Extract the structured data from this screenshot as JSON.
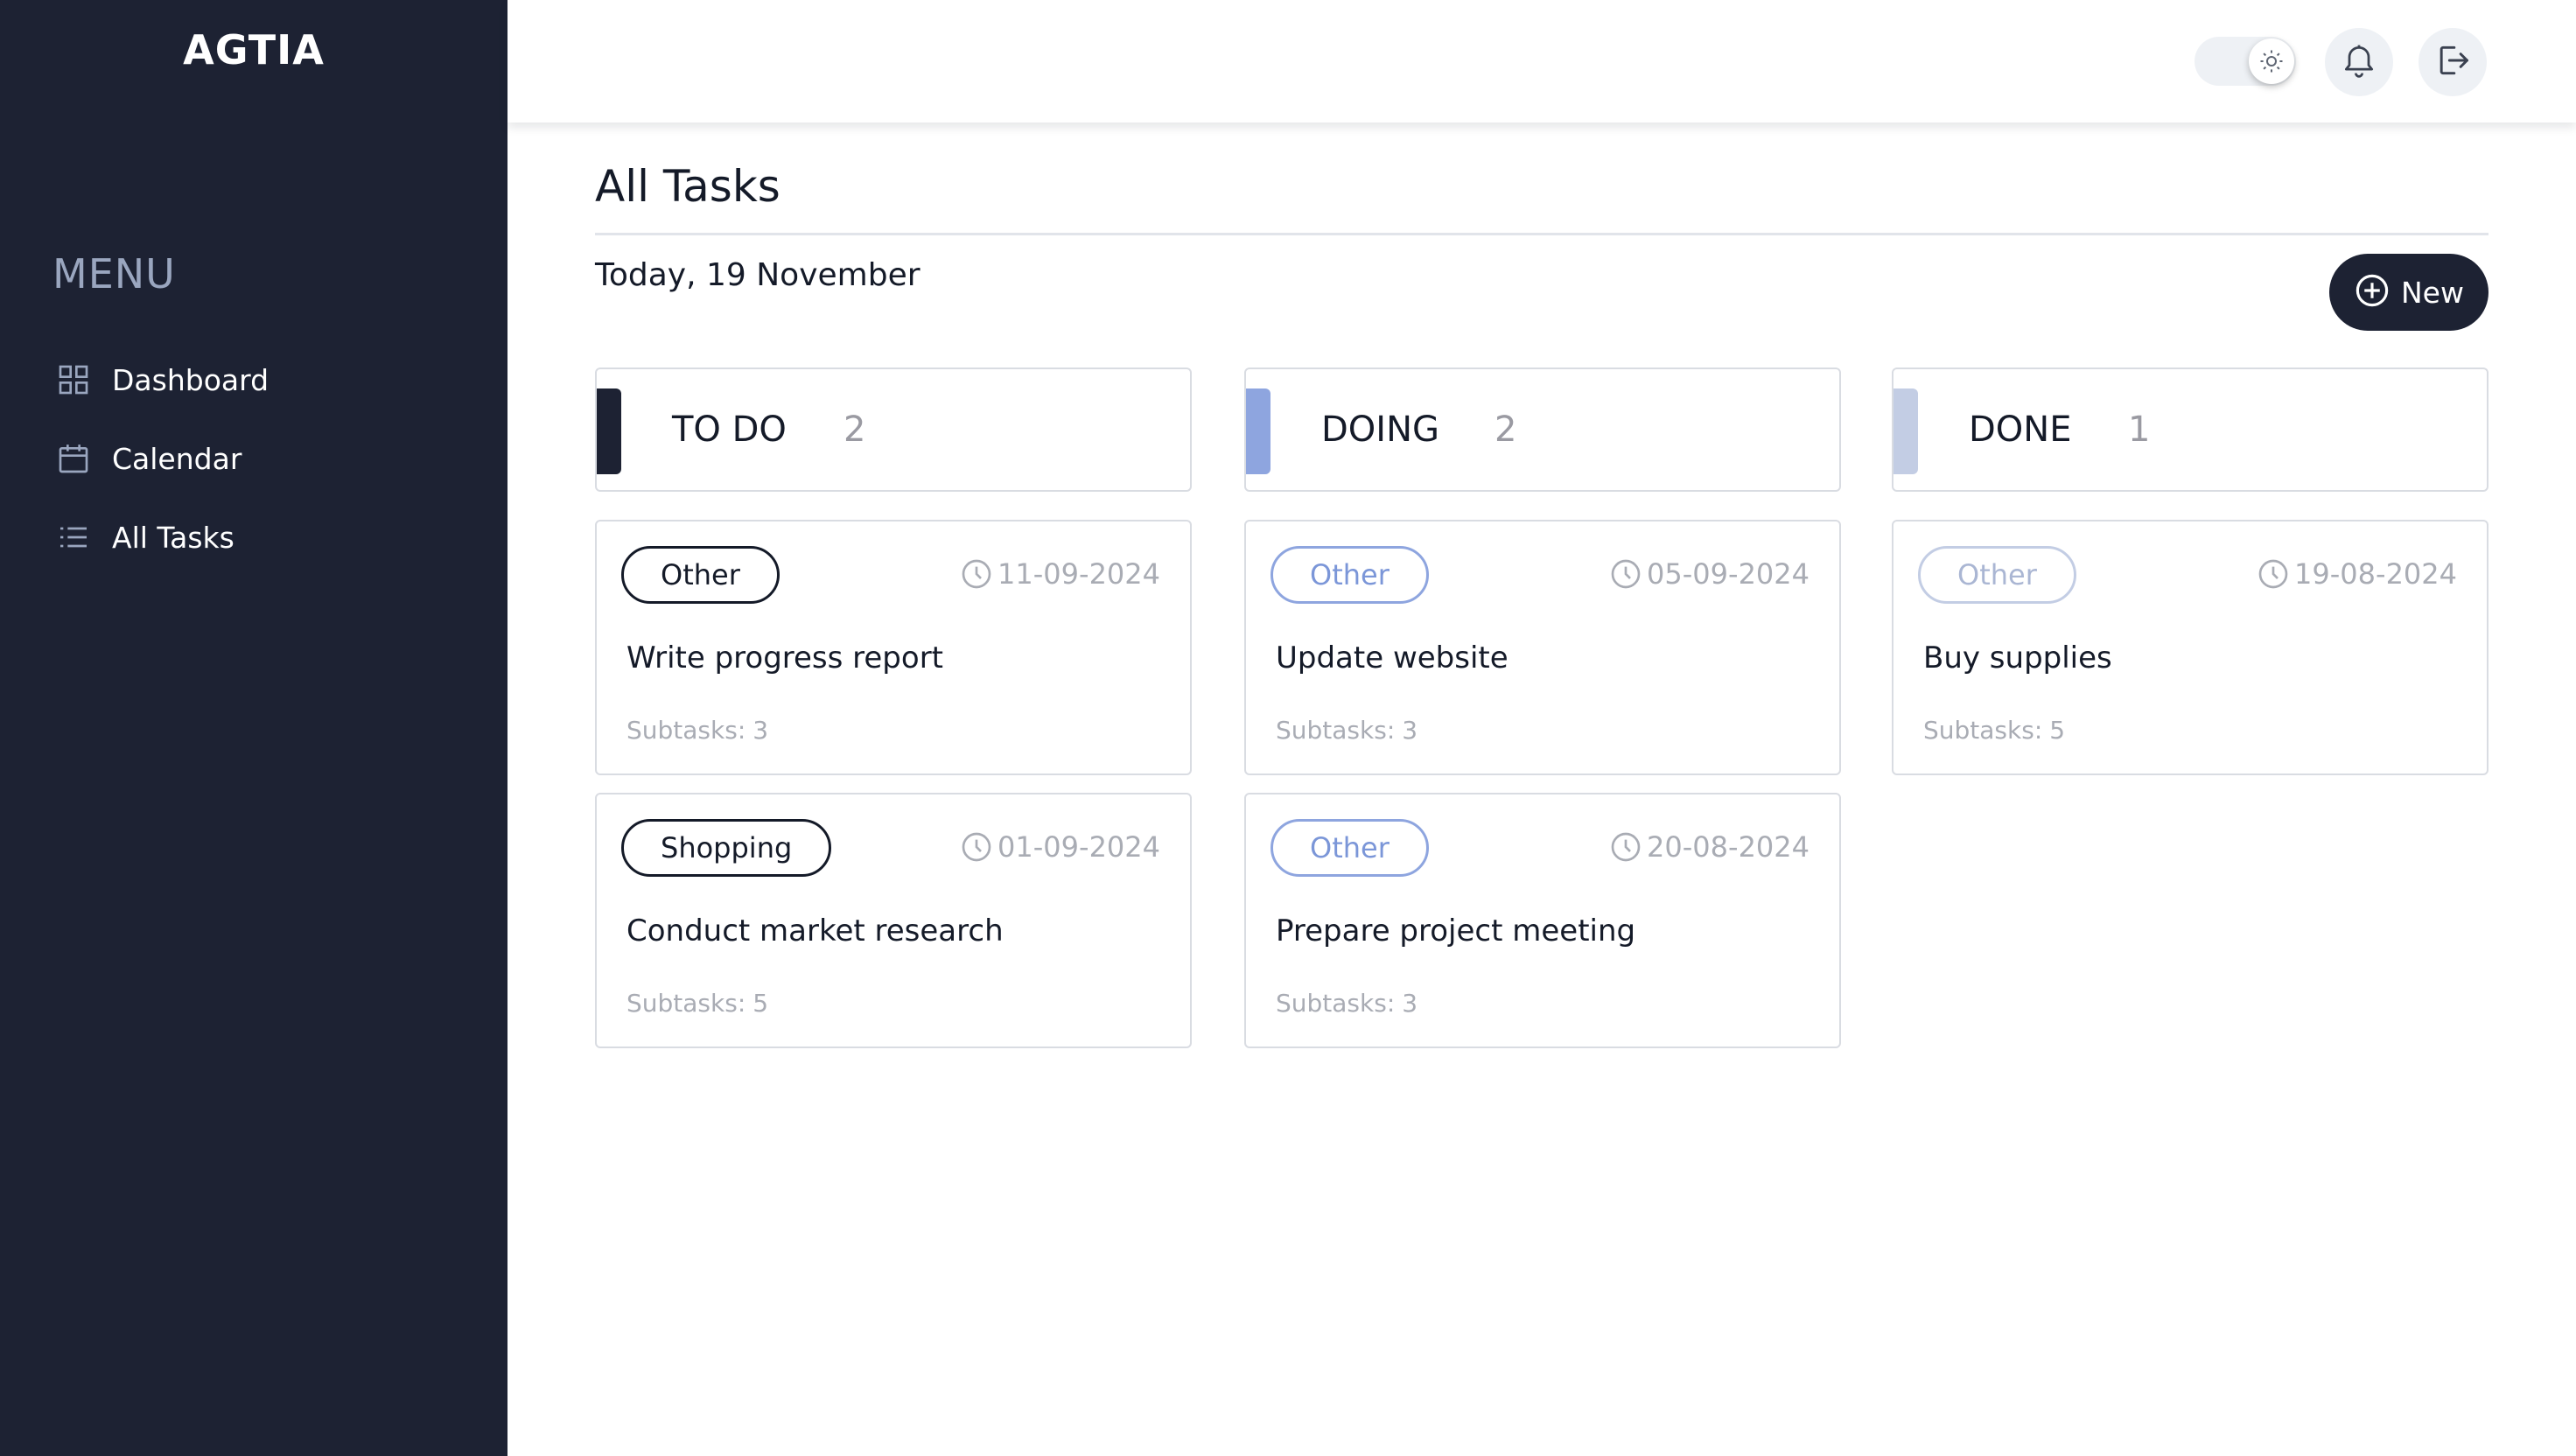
{
  "app": {
    "logo": "AGTIA"
  },
  "sidebar": {
    "menu_title": "MENU",
    "items": [
      {
        "label": "Dashboard",
        "icon": "grid-icon"
      },
      {
        "label": "Calendar",
        "icon": "calendar-icon"
      },
      {
        "label": "All Tasks",
        "icon": "list-icon"
      }
    ]
  },
  "header": {
    "theme_toggle_icon": "sun-icon",
    "notification_icon": "bell-icon",
    "logout_icon": "logout-icon"
  },
  "main": {
    "title": "All Tasks",
    "today": "Today, 19 November",
    "new_button": "New"
  },
  "columns": [
    {
      "name": "TO DO",
      "count": "2",
      "accent": "#1d2233",
      "cards": [
        {
          "tag": "Other",
          "date": "11-09-2024",
          "title": "Write progress report",
          "subtasks_label": "Subtasks:",
          "subtasks": "3"
        },
        {
          "tag": "Shopping",
          "date": "01-09-2024",
          "title": "Conduct market research",
          "subtasks_label": "Subtasks:",
          "subtasks": "5"
        }
      ]
    },
    {
      "name": "DOING",
      "count": "2",
      "accent": "#8ea5df",
      "cards": [
        {
          "tag": "Other",
          "date": "05-09-2024",
          "title": "Update website",
          "subtasks_label": "Subtasks:",
          "subtasks": "3"
        },
        {
          "tag": "Other",
          "date": "20-08-2024",
          "title": "Prepare project meeting",
          "subtasks_label": "Subtasks:",
          "subtasks": "3"
        }
      ]
    },
    {
      "name": "DONE",
      "count": "1",
      "accent": "#c3cde4",
      "cards": [
        {
          "tag": "Other",
          "date": "19-08-2024",
          "title": "Buy supplies",
          "subtasks_label": "Subtasks:",
          "subtasks": "5"
        }
      ]
    }
  ],
  "colors": {
    "sidebar_bg": "#1d2233",
    "primary_dark": "#1d2233",
    "doing_blue": "#8ea5df",
    "done_pale": "#c3cde4",
    "muted_text": "#a9acb4"
  }
}
